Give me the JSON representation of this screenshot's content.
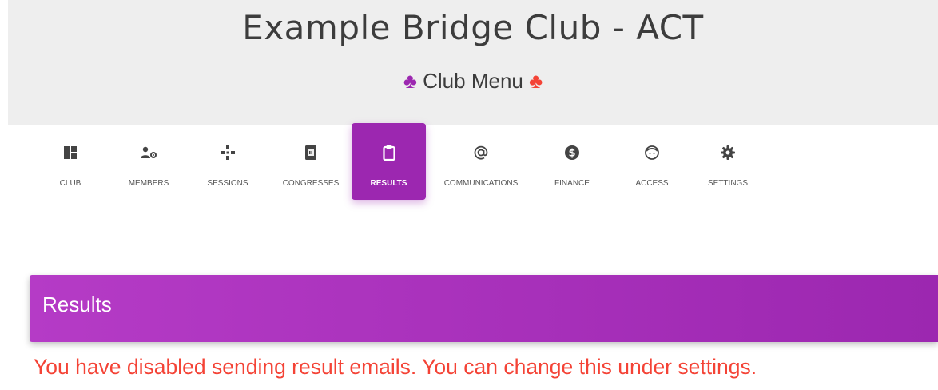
{
  "header": {
    "title": "Example Bridge Club - ACT",
    "menu_label": "Club Menu",
    "suit_symbol": "♣"
  },
  "nav": {
    "items": [
      {
        "label": "CLUB",
        "icon": "dashboard-icon"
      },
      {
        "label": "MEMBERS",
        "icon": "members-settings-icon"
      },
      {
        "label": "SESSIONS",
        "icon": "sessions-icon"
      },
      {
        "label": "CONGRESSES",
        "icon": "calendar-icon"
      },
      {
        "label": "RESULTS",
        "icon": "clipboard-icon",
        "active": true
      },
      {
        "label": "COMMUNICATIONS",
        "icon": "at-icon"
      },
      {
        "label": "FINANCE",
        "icon": "dollar-icon"
      },
      {
        "label": "ACCESS",
        "icon": "face-icon"
      },
      {
        "label": "SETTINGS",
        "icon": "gear-icon"
      }
    ]
  },
  "results": {
    "title": "Results",
    "warning": "You have disabled sending result emails. You can change this under settings."
  },
  "colors": {
    "accent": "#9c27b0",
    "warning": "#f44336",
    "header_bg": "#eeeeee"
  }
}
